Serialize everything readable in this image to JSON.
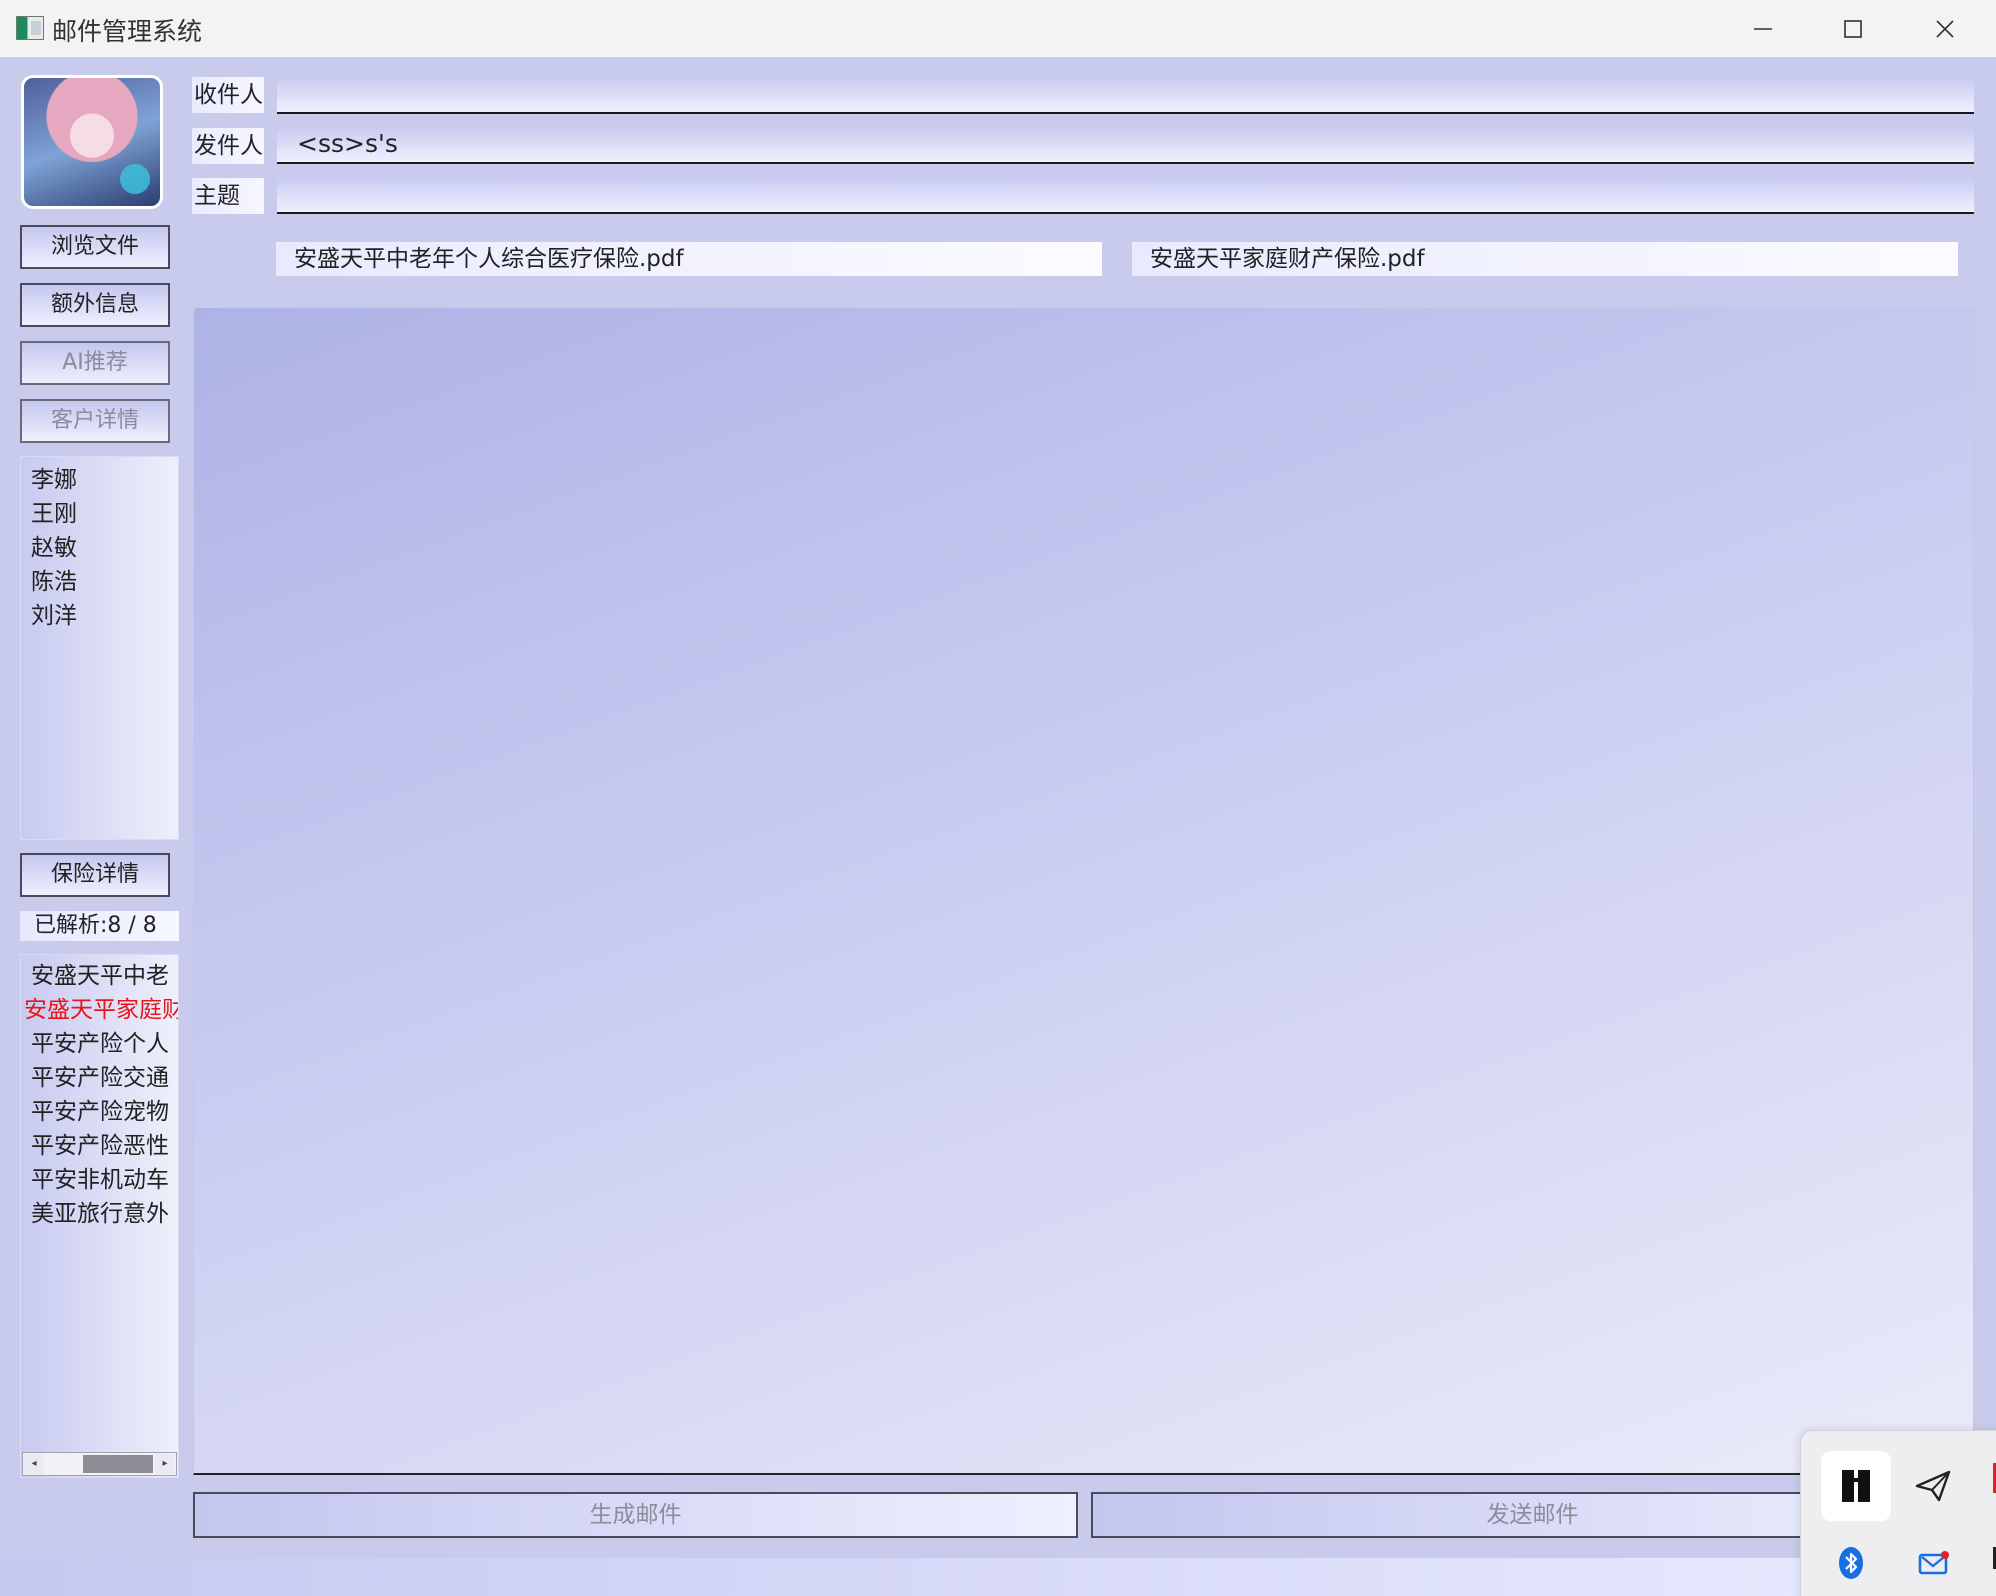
{
  "window": {
    "title": "邮件管理系统",
    "controls": {
      "minimize": "—",
      "maximize": "☐",
      "close": "✕"
    }
  },
  "sidebar": {
    "buttons": {
      "browse_files": "浏览文件",
      "extra_info": "额外信息",
      "ai_recommend": "AI推荐",
      "customer_details": "客户详情",
      "insurance_details": "保险详情"
    },
    "customers": [
      "李娜",
      "王刚",
      "赵敏",
      "陈浩",
      "刘洋"
    ],
    "parsed_status": "已解析:8 / 8",
    "policies": [
      "安盛天平中老",
      "安盛天平家庭财",
      "平安产险个人",
      "平安产险交通",
      "平安产险宠物",
      "平安产险恶性",
      "平安非机动车",
      "美亚旅行意外"
    ],
    "selected_policy_index": 1,
    "selected_color": "#e8141c"
  },
  "form": {
    "recipient_label": "收件人",
    "recipient_value": "",
    "sender_label": "发件人",
    "sender_value": "<ss>s's",
    "subject_label": "主题",
    "subject_value": ""
  },
  "attachments": [
    "安盛天平中老年个人综合医疗保险.pdf",
    "安盛天平家庭财产保险.pdf"
  ],
  "body_text": "",
  "actions": {
    "generate": "生成邮件",
    "send": "发送邮件"
  },
  "tray": {
    "icons": [
      "bookmark-app-icon",
      "paper-plane-icon",
      "bluetooth-icon",
      "mail-app-icon"
    ]
  }
}
